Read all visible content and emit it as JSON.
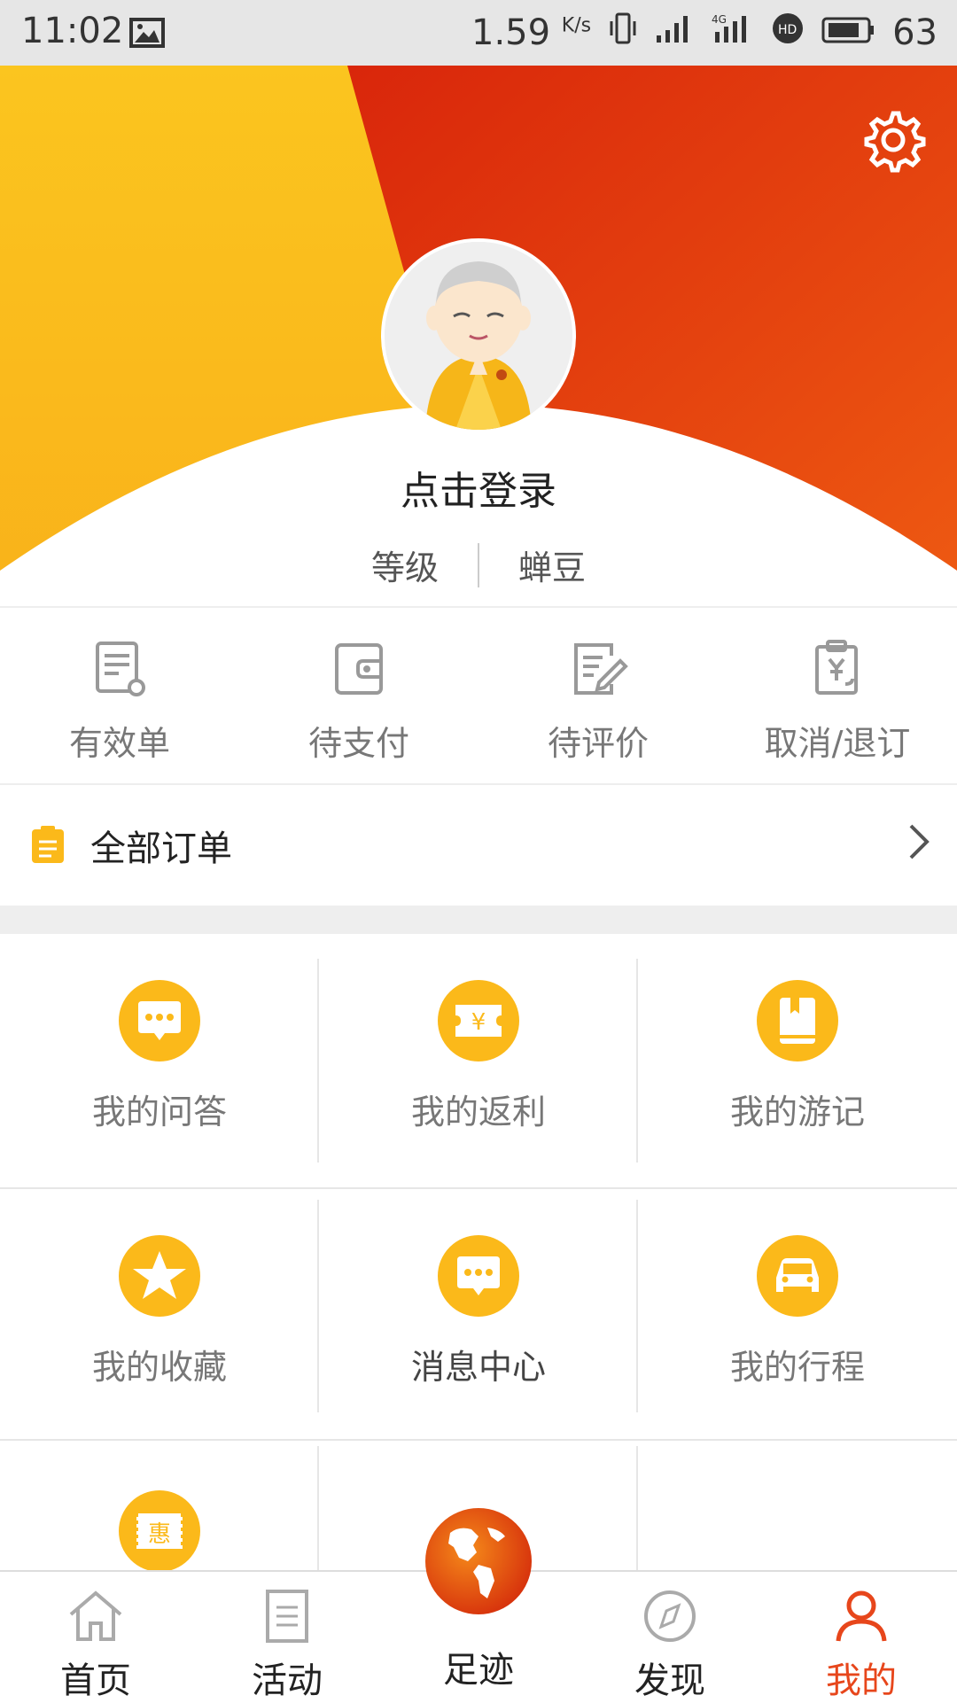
{
  "status_bar": {
    "time": "11:02",
    "speed": "1.59",
    "speed_unit": "K/s",
    "battery": "63"
  },
  "header": {
    "login_text": "点击登录",
    "level_label": "等级",
    "beans_label": "蝉豆"
  },
  "order_status": [
    {
      "label": "有效单",
      "icon": "valid-order-icon"
    },
    {
      "label": "待支付",
      "icon": "wallet-icon"
    },
    {
      "label": "待评价",
      "icon": "edit-review-icon"
    },
    {
      "label": "取消/退订",
      "icon": "refund-icon"
    }
  ],
  "all_orders": {
    "label": "全部订单"
  },
  "grid_items": [
    {
      "label": "我的问答",
      "icon": "chat-icon"
    },
    {
      "label": "我的返利",
      "icon": "coupon-yen-icon"
    },
    {
      "label": "我的游记",
      "icon": "book-icon"
    },
    {
      "label": "我的收藏",
      "icon": "star-icon"
    },
    {
      "label": "消息中心",
      "icon": "message-icon"
    },
    {
      "label": "我的行程",
      "icon": "car-icon"
    },
    {
      "label": "惠",
      "icon": "discount-ticket-icon"
    }
  ],
  "bottom_nav": [
    {
      "label": "首页",
      "icon": "home-icon"
    },
    {
      "label": "活动",
      "icon": "activity-icon"
    },
    {
      "label": "足迹",
      "icon": "globe-icon"
    },
    {
      "label": "发现",
      "icon": "compass-icon"
    },
    {
      "label": "我的",
      "icon": "user-icon",
      "active": true
    }
  ],
  "colors": {
    "accent": "#fbb91a",
    "active_tab": "#e7461b",
    "header_red": "#dd2f0c"
  }
}
